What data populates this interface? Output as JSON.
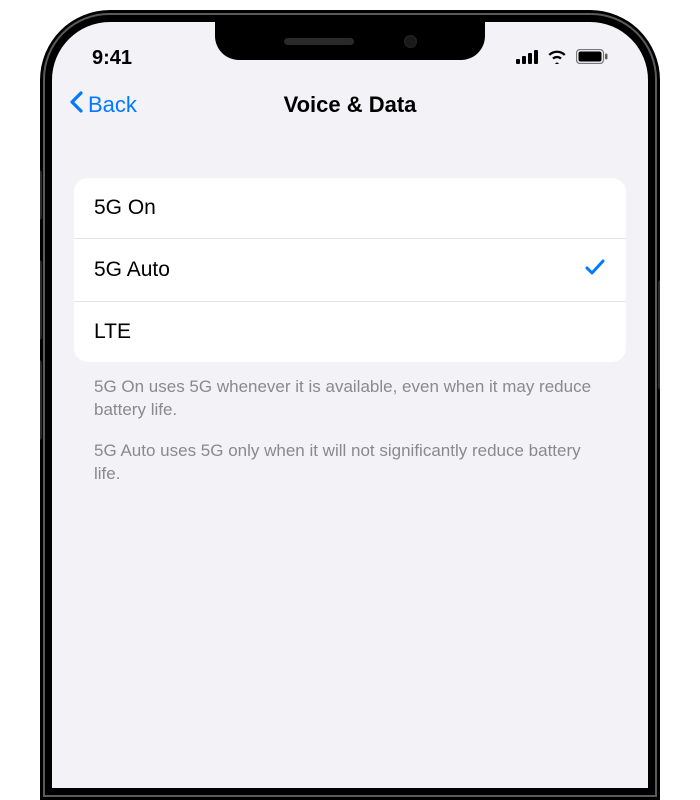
{
  "statusBar": {
    "time": "9:41"
  },
  "nav": {
    "back": "Back",
    "title": "Voice & Data"
  },
  "options": [
    {
      "label": "5G On",
      "selected": false
    },
    {
      "label": "5G Auto",
      "selected": true
    },
    {
      "label": "LTE",
      "selected": false
    }
  ],
  "footer1": "5G On uses 5G whenever it is available, even when it may reduce battery life.",
  "footer2": "5G Auto uses 5G only when it will not significantly reduce battery life."
}
